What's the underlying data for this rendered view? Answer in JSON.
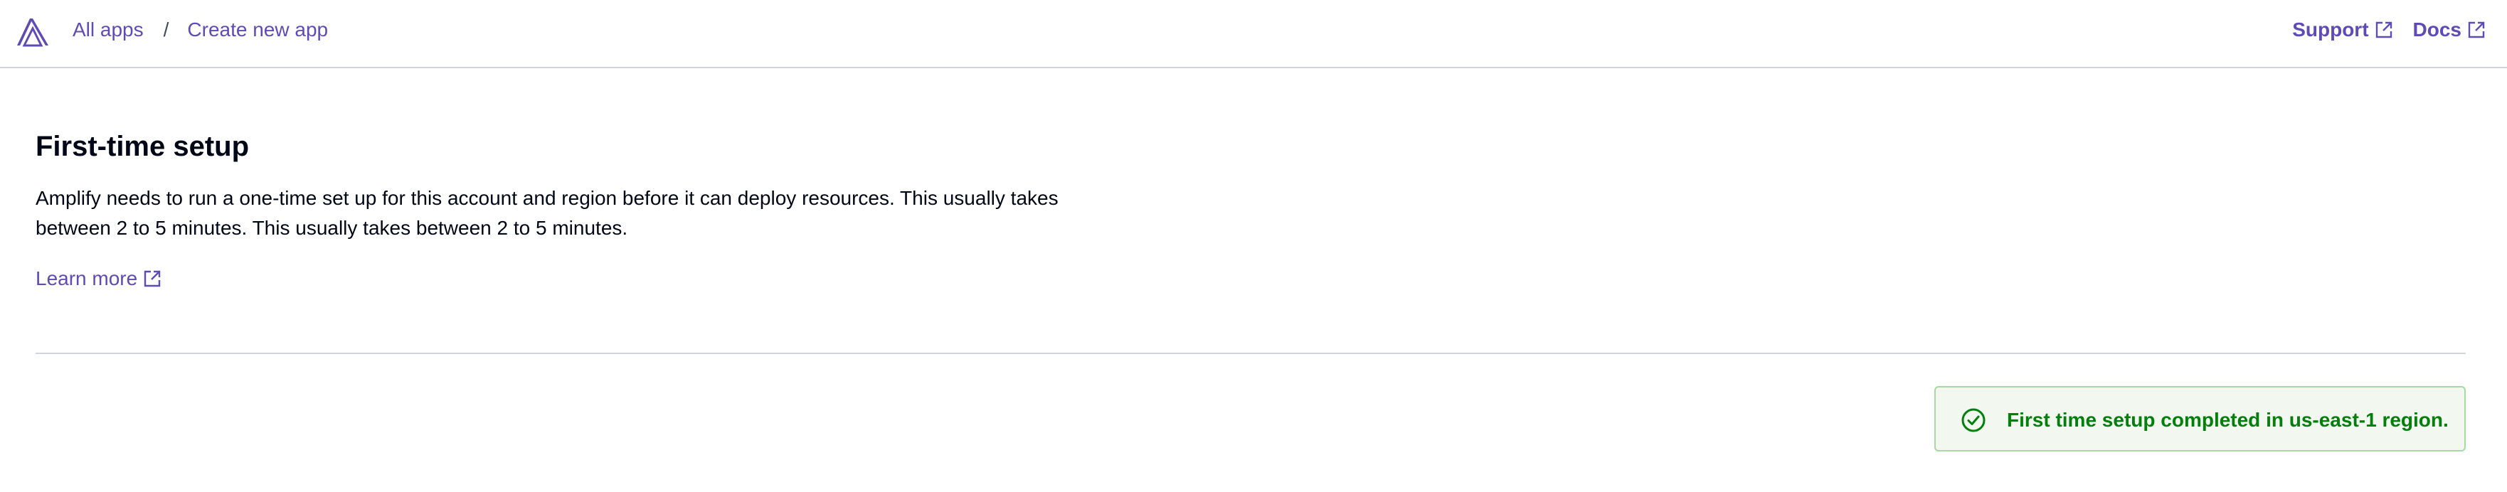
{
  "header": {
    "breadcrumbs": [
      "All apps",
      "Create new app"
    ],
    "separator": "/",
    "links": {
      "support": "Support",
      "docs": "Docs"
    }
  },
  "main": {
    "title": "First-time setup",
    "description": "Amplify needs to run a one-time set up for this account and region before it can deploy resources. This usually takes between 2 to 5 minutes. This usually takes between 2 to 5 minutes.",
    "learn_more": "Learn more"
  },
  "notification": {
    "type": "success",
    "message": "First time setup completed in us-east-1 region."
  },
  "colors": {
    "link": "#5f4bb6",
    "success_text": "#037f0c",
    "success_bg": "#f2f8f0",
    "success_border": "#a8d8a3",
    "divider": "#d1d5db"
  },
  "icons": {
    "logo": "amplify-logo",
    "external": "external-link-icon",
    "success": "check-circle-icon"
  }
}
